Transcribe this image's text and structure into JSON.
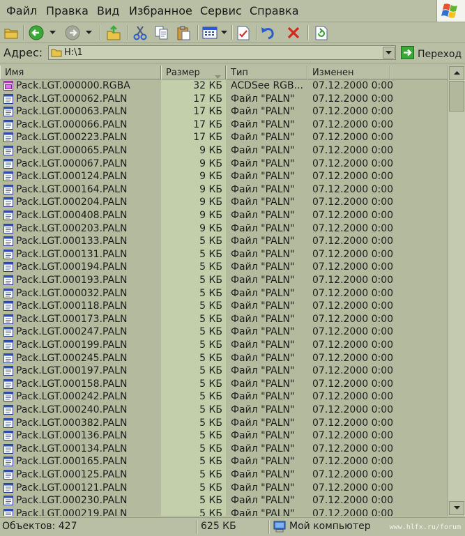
{
  "menu": {
    "items": [
      "Файл",
      "Правка",
      "Вид",
      "Избранное",
      "Сервис",
      "Справка"
    ]
  },
  "address": {
    "label": "Адрес:",
    "value": "H:\\1",
    "go_label": "Переход"
  },
  "columns": {
    "name": "Имя",
    "size": "Размер",
    "type": "Тип",
    "modified": "Изменен"
  },
  "files": [
    {
      "name": "Pack.LGT.000000.RGBA",
      "size": "32 КБ",
      "type": "ACDSee RGB...",
      "date": "07.12.2000 0:00",
      "icon": "acdsee-image-icon"
    },
    {
      "name": "Pack.LGT.000062.PALN",
      "size": "17 КБ",
      "type": "Файл \"PALN\"",
      "date": "07.12.2000 0:00",
      "icon": "file-icon"
    },
    {
      "name": "Pack.LGT.000063.PALN",
      "size": "17 КБ",
      "type": "Файл \"PALN\"",
      "date": "07.12.2000 0:00",
      "icon": "file-icon"
    },
    {
      "name": "Pack.LGT.000066.PALN",
      "size": "17 КБ",
      "type": "Файл \"PALN\"",
      "date": "07.12.2000 0:00",
      "icon": "file-icon"
    },
    {
      "name": "Pack.LGT.000223.PALN",
      "size": "17 КБ",
      "type": "Файл \"PALN\"",
      "date": "07.12.2000 0:00",
      "icon": "file-icon"
    },
    {
      "name": "Pack.LGT.000065.PALN",
      "size": "9 КБ",
      "type": "Файл \"PALN\"",
      "date": "07.12.2000 0:00",
      "icon": "file-icon"
    },
    {
      "name": "Pack.LGT.000067.PALN",
      "size": "9 КБ",
      "type": "Файл \"PALN\"",
      "date": "07.12.2000 0:00",
      "icon": "file-icon"
    },
    {
      "name": "Pack.LGT.000124.PALN",
      "size": "9 КБ",
      "type": "Файл \"PALN\"",
      "date": "07.12.2000 0:00",
      "icon": "file-icon"
    },
    {
      "name": "Pack.LGT.000164.PALN",
      "size": "9 КБ",
      "type": "Файл \"PALN\"",
      "date": "07.12.2000 0:00",
      "icon": "file-icon"
    },
    {
      "name": "Pack.LGT.000204.PALN",
      "size": "9 КБ",
      "type": "Файл \"PALN\"",
      "date": "07.12.2000 0:00",
      "icon": "file-icon"
    },
    {
      "name": "Pack.LGT.000408.PALN",
      "size": "9 КБ",
      "type": "Файл \"PALN\"",
      "date": "07.12.2000 0:00",
      "icon": "file-icon"
    },
    {
      "name": "Pack.LGT.000203.PALN",
      "size": "9 КБ",
      "type": "Файл \"PALN\"",
      "date": "07.12.2000 0:00",
      "icon": "file-icon"
    },
    {
      "name": "Pack.LGT.000133.PALN",
      "size": "5 КБ",
      "type": "Файл \"PALN\"",
      "date": "07.12.2000 0:00",
      "icon": "file-icon"
    },
    {
      "name": "Pack.LGT.000131.PALN",
      "size": "5 КБ",
      "type": "Файл \"PALN\"",
      "date": "07.12.2000 0:00",
      "icon": "file-icon"
    },
    {
      "name": "Pack.LGT.000194.PALN",
      "size": "5 КБ",
      "type": "Файл \"PALN\"",
      "date": "07.12.2000 0:00",
      "icon": "file-icon"
    },
    {
      "name": "Pack.LGT.000193.PALN",
      "size": "5 КБ",
      "type": "Файл \"PALN\"",
      "date": "07.12.2000 0:00",
      "icon": "file-icon"
    },
    {
      "name": "Pack.LGT.000032.PALN",
      "size": "5 КБ",
      "type": "Файл \"PALN\"",
      "date": "07.12.2000 0:00",
      "icon": "file-icon"
    },
    {
      "name": "Pack.LGT.000118.PALN",
      "size": "5 КБ",
      "type": "Файл \"PALN\"",
      "date": "07.12.2000 0:00",
      "icon": "file-icon"
    },
    {
      "name": "Pack.LGT.000173.PALN",
      "size": "5 КБ",
      "type": "Файл \"PALN\"",
      "date": "07.12.2000 0:00",
      "icon": "file-icon"
    },
    {
      "name": "Pack.LGT.000247.PALN",
      "size": "5 КБ",
      "type": "Файл \"PALN\"",
      "date": "07.12.2000 0:00",
      "icon": "file-icon"
    },
    {
      "name": "Pack.LGT.000199.PALN",
      "size": "5 КБ",
      "type": "Файл \"PALN\"",
      "date": "07.12.2000 0:00",
      "icon": "file-icon"
    },
    {
      "name": "Pack.LGT.000245.PALN",
      "size": "5 КБ",
      "type": "Файл \"PALN\"",
      "date": "07.12.2000 0:00",
      "icon": "file-icon"
    },
    {
      "name": "Pack.LGT.000197.PALN",
      "size": "5 КБ",
      "type": "Файл \"PALN\"",
      "date": "07.12.2000 0:00",
      "icon": "file-icon"
    },
    {
      "name": "Pack.LGT.000158.PALN",
      "size": "5 КБ",
      "type": "Файл \"PALN\"",
      "date": "07.12.2000 0:00",
      "icon": "file-icon"
    },
    {
      "name": "Pack.LGT.000242.PALN",
      "size": "5 КБ",
      "type": "Файл \"PALN\"",
      "date": "07.12.2000 0:00",
      "icon": "file-icon"
    },
    {
      "name": "Pack.LGT.000240.PALN",
      "size": "5 КБ",
      "type": "Файл \"PALN\"",
      "date": "07.12.2000 0:00",
      "icon": "file-icon"
    },
    {
      "name": "Pack.LGT.000382.PALN",
      "size": "5 КБ",
      "type": "Файл \"PALN\"",
      "date": "07.12.2000 0:00",
      "icon": "file-icon"
    },
    {
      "name": "Pack.LGT.000136.PALN",
      "size": "5 КБ",
      "type": "Файл \"PALN\"",
      "date": "07.12.2000 0:00",
      "icon": "file-icon"
    },
    {
      "name": "Pack.LGT.000134.PALN",
      "size": "5 КБ",
      "type": "Файл \"PALN\"",
      "date": "07.12.2000 0:00",
      "icon": "file-icon"
    },
    {
      "name": "Pack.LGT.000165.PALN",
      "size": "5 КБ",
      "type": "Файл \"PALN\"",
      "date": "07.12.2000 0:00",
      "icon": "file-icon"
    },
    {
      "name": "Pack.LGT.000125.PALN",
      "size": "5 КБ",
      "type": "Файл \"PALN\"",
      "date": "07.12.2000 0:00",
      "icon": "file-icon"
    },
    {
      "name": "Pack.LGT.000121.PALN",
      "size": "5 КБ",
      "type": "Файл \"PALN\"",
      "date": "07.12.2000 0:00",
      "icon": "file-icon"
    },
    {
      "name": "Pack.LGT.000230.PALN",
      "size": "5 КБ",
      "type": "Файл \"PALN\"",
      "date": "07.12.2000 0:00",
      "icon": "file-icon"
    },
    {
      "name": "Pack.LGT.000219.PALN",
      "size": "5 КБ",
      "type": "Файл \"PALN\"",
      "date": "07.12.2000 0:00",
      "icon": "file-icon"
    }
  ],
  "status": {
    "objects": "Объектов: 427",
    "total_size": "625 КБ",
    "location": "Мой компьютер",
    "watermark": "www.hlfx.ru/forum"
  },
  "icons": {
    "toolbar": [
      "folder-up-icon",
      "back-icon",
      "forward-icon",
      "move-to-icon",
      "cut-icon",
      "copy-icon",
      "paste-icon",
      "views-icon",
      "properties-icon",
      "undo-icon",
      "delete-icon",
      "refresh-icon"
    ],
    "status_location": "my-computer-icon",
    "brand": "windows-logo-icon"
  },
  "colors": {
    "window_bg": "#b9bfa4",
    "list_bg": "#b3ba9d",
    "sorted_column_bg": "#c3ceab",
    "text": "#1c1c1c"
  }
}
